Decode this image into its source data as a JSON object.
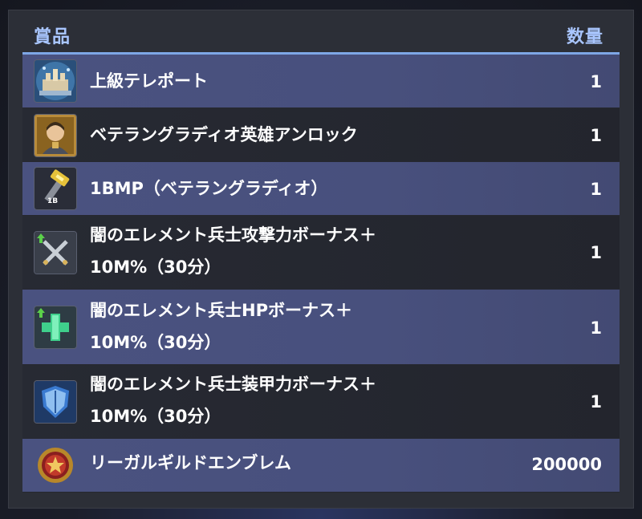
{
  "header": {
    "reward_label": "賞品",
    "quantity_label": "数量"
  },
  "rewards": [
    {
      "name_line1": "上級テレポート",
      "name_line2": "",
      "quantity": "1",
      "icon": "castle-teleport-icon"
    },
    {
      "name_line1": "ベテラングラディオ英雄アンロック",
      "name_line2": "",
      "quantity": "1",
      "icon": "hero-portrait-icon"
    },
    {
      "name_line1": "1BMP（ベテラングラディオ）",
      "name_line2": "",
      "quantity": "1",
      "icon": "hammer-icon",
      "icon_badge": "1B"
    },
    {
      "name_line1": "闇のエレメント兵士攻撃力ボーナス＋",
      "name_line2": "10M%（30分）",
      "quantity": "1",
      "icon": "crossed-swords-icon"
    },
    {
      "name_line1": "闇のエレメント兵士HPボーナス＋",
      "name_line2": "10M%（30分）",
      "quantity": "1",
      "icon": "health-cross-icon"
    },
    {
      "name_line1": "闇のエレメント兵士装甲力ボーナス＋",
      "name_line2": "10M%（30分）",
      "quantity": "1",
      "icon": "armor-shield-icon"
    },
    {
      "name_line1": "リーガルギルドエンブレム",
      "name_line2": "",
      "quantity": "200000",
      "icon": "guild-emblem-icon"
    }
  ],
  "colors": {
    "header_text": "#a9c6ff",
    "row_light": "#4a5280",
    "row_dark": "#25272f",
    "boost_arrow": "#5bd04a"
  }
}
